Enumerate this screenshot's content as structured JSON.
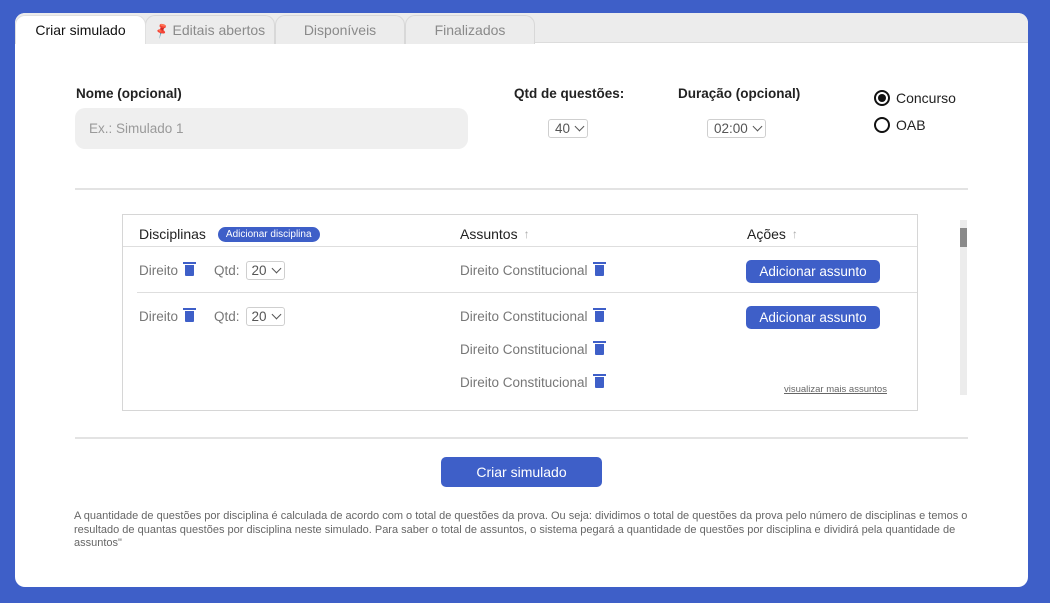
{
  "tabs": [
    {
      "label": "Criar simulado",
      "active": true
    },
    {
      "label": "Editais abertos",
      "icon": "pin-icon"
    },
    {
      "label": "Disponíveis"
    },
    {
      "label": "Finalizados"
    }
  ],
  "form": {
    "name_label": "Nome (opcional)",
    "name_placeholder": "Ex.: Simulado 1",
    "qtd_label": "Qtd de questões:",
    "qtd_value": "40",
    "duration_label": "Duração (opcional)",
    "duration_value": "02:00",
    "radio_options": [
      {
        "label": "Concurso",
        "selected": true
      },
      {
        "label": "OAB",
        "selected": false
      }
    ]
  },
  "table": {
    "headers": {
      "disciplinas": "Disciplinas",
      "add_disciplina": "Adicionar disciplina",
      "assuntos": "Assuntos",
      "acoes": "Ações"
    },
    "rows": [
      {
        "disciplina": "Direito",
        "qtd_label": "Qtd:",
        "qtd_value": "20",
        "assuntos": [
          "Direito Constitucional"
        ],
        "action": "Adicionar assunto"
      },
      {
        "disciplina": "Direito",
        "qtd_label": "Qtd:",
        "qtd_value": "20",
        "assuntos": [
          "Direito Constitucional",
          "Direito Constitucional",
          "Direito Constitucional"
        ],
        "action": "Adicionar assunto",
        "more_link": "visualizar mais assuntos"
      }
    ]
  },
  "submit_label": "Criar simulado",
  "footnote": "A quantidade de questões por disciplina é calculada de acordo com o total de questões da prova. Ou seja: dividimos o total de questões da prova pelo número de disciplinas e temos o resultado de quantas questões por disciplina neste simulado. Para saber o total de assuntos, o sistema pegará a quantidade de questões por disciplina e dividirá pela quantidade de assuntos\"",
  "colors": {
    "background": "#3e5fc8",
    "accent": "#3e5fc8"
  }
}
